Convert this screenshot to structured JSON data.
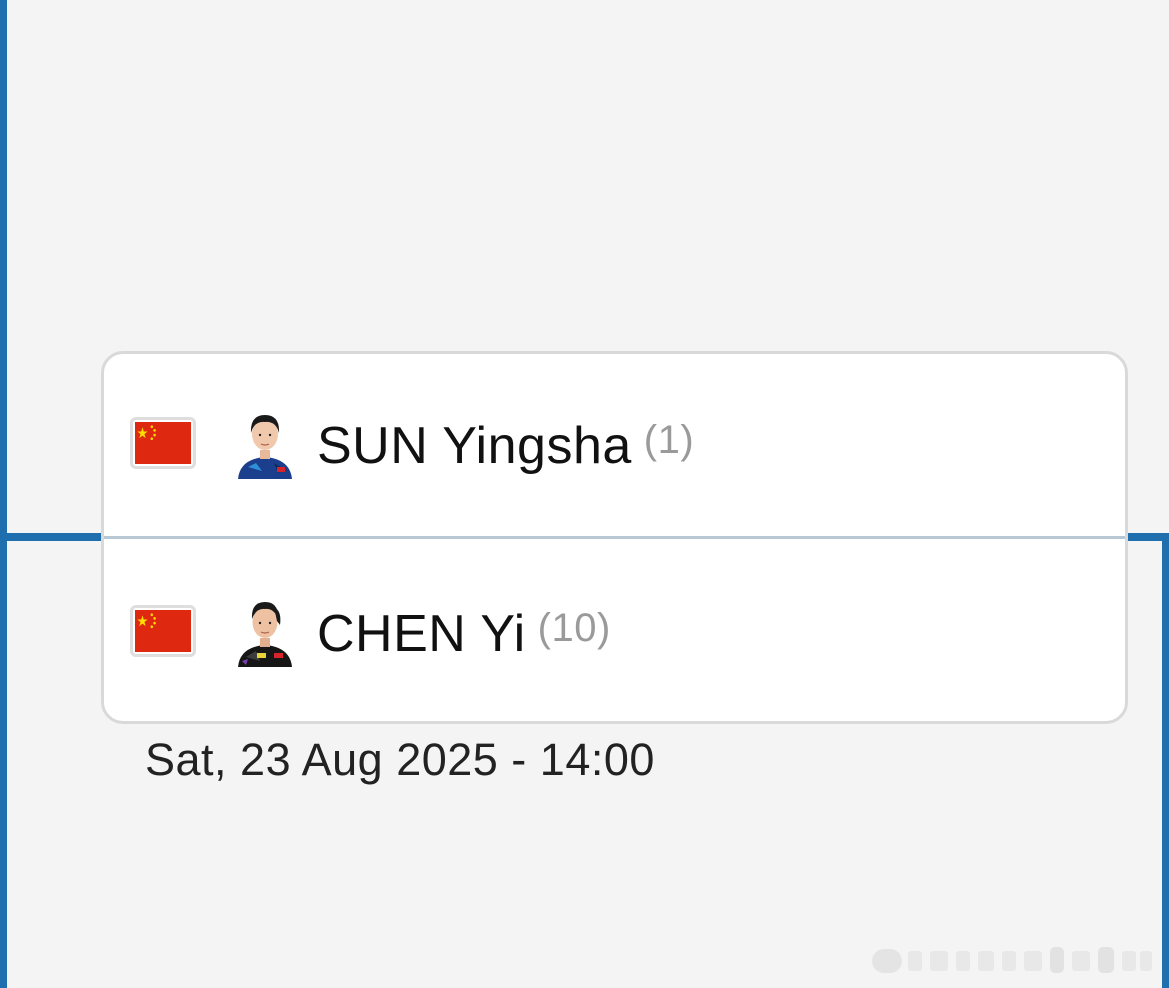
{
  "colors": {
    "bracket": "#1f6fae",
    "background": "#f4f4f4",
    "card": "#ffffff",
    "seed": "#9a9a9a"
  },
  "match": {
    "players": [
      {
        "country_icon": "china-flag-icon",
        "avatar_icon": "player-avatar",
        "name": "SUN Yingsha",
        "seed": "(1)"
      },
      {
        "country_icon": "china-flag-icon",
        "avatar_icon": "player-avatar",
        "name": "CHEN Yi",
        "seed": "(10)"
      }
    ],
    "datetime": "Sat, 23 Aug 2025 - 14:00"
  }
}
